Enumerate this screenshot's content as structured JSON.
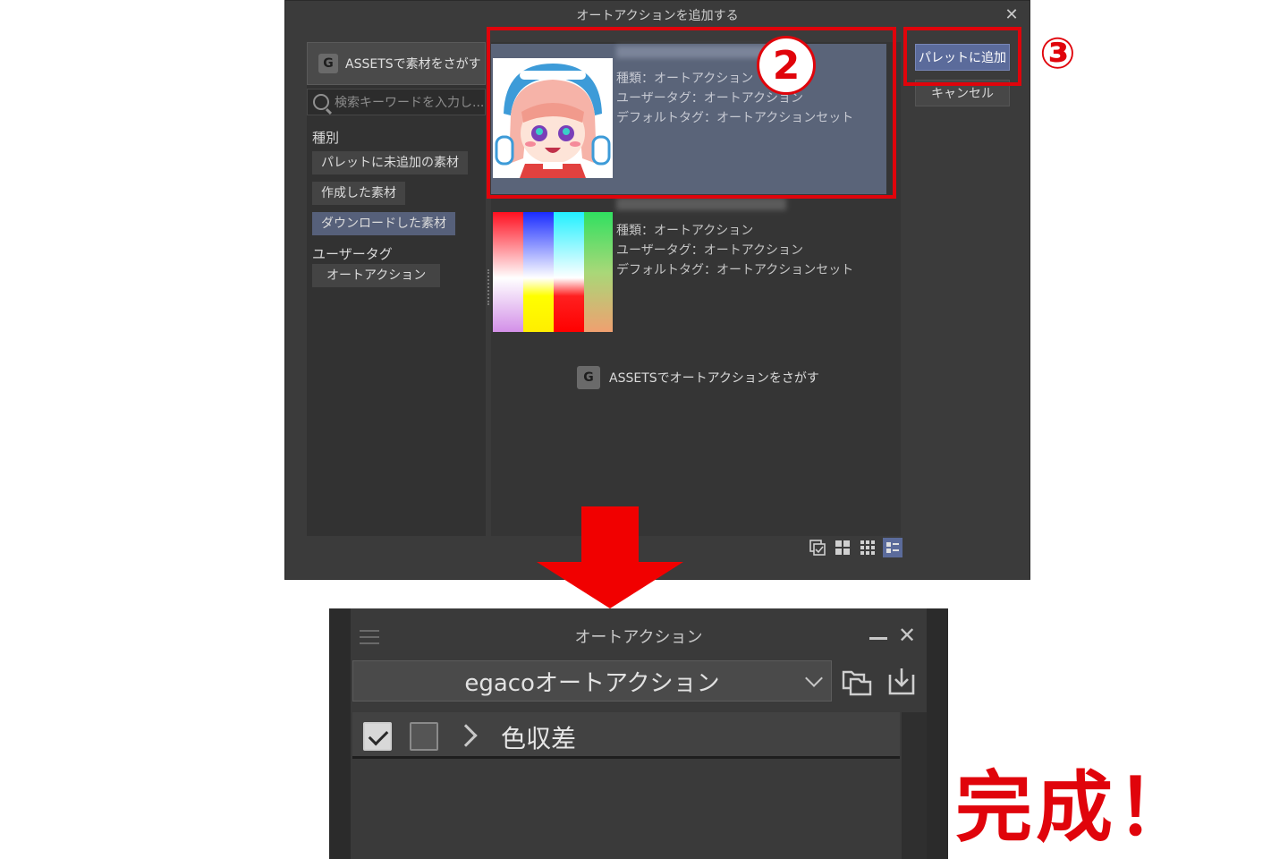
{
  "dialog": {
    "title": "オートアクションを追加する",
    "close_glyph": "✕",
    "assets_button": "ASSETSで素材をさがす",
    "search_placeholder": "検索キーワードを入力し...",
    "category_label": "種別",
    "categories": [
      {
        "label": "パレットに未追加の素材",
        "active": false
      },
      {
        "label": "作成した素材",
        "active": false
      },
      {
        "label": "ダウンロードした素材",
        "active": true
      }
    ],
    "usertag_label": "ユーザータグ",
    "usertags": [
      {
        "label": "オートアクション"
      }
    ],
    "items": [
      {
        "selected": true,
        "kind": "種類：オートアクション",
        "user_tag": "ユーザータグ：オートアクション",
        "default_tag": "デフォルトタグ：オートアクションセット"
      },
      {
        "selected": false,
        "kind": "種類：オートアクション",
        "user_tag": "ユーザータグ：オートアクション",
        "default_tag": "デフォルトタグ：オートアクションセット"
      }
    ],
    "assets_link": "ASSETSでオートアクションをさがす",
    "add_button": "パレットに追加",
    "cancel_button": "キャンセル",
    "view_modes": [
      "check-view-icon",
      "large-grid-icon",
      "small-grid-icon",
      "list-view-icon"
    ]
  },
  "annotations": {
    "step2": "2",
    "step3": "③",
    "done": "完成！",
    "accent_color": "#e0040b"
  },
  "palette": {
    "title": "オートアクション",
    "close_glyph": "✕",
    "set_name": "egacoオートアクション",
    "row_label": "色収差",
    "row_enabled": true,
    "row_dialog": false
  },
  "colors": {
    "selected_row": "#5a6479",
    "primary_button": "#5b6b9b"
  }
}
